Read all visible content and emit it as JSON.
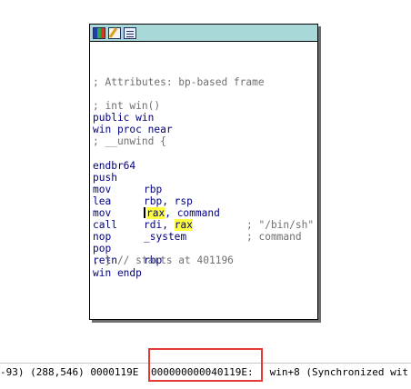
{
  "node": {
    "toolbar_icons": [
      "graph-overview-icon",
      "edit-node-icon",
      "code-view-icon"
    ],
    "attributes_comment": "; Attributes: bp-based frame",
    "signature_comment": "; int win()",
    "public_decl": "public win",
    "proc_decl": "win proc near",
    "unwind_start": "; __unwind {",
    "instructions": [
      {
        "mnemonic": "endbr64",
        "operand": "",
        "comment": ""
      },
      {
        "mnemonic": "push",
        "operand": "rbp",
        "comment": ""
      },
      {
        "mnemonic": "mov",
        "operand": "rbp, rsp",
        "comment": ""
      },
      {
        "mnemonic": "lea",
        "operand": "rax, command",
        "comment": "; \"/bin/sh\""
      },
      {
        "mnemonic": "mov",
        "operand": "rdi, rax",
        "comment": "; command"
      },
      {
        "mnemonic": "call",
        "operand": "_system",
        "comment": ""
      },
      {
        "mnemonic": "nop",
        "operand": "",
        "comment": ""
      },
      {
        "mnemonic": "pop",
        "operand": "rbp",
        "comment": ""
      },
      {
        "mnemonic": "retn",
        "operand": "",
        "comment": ""
      }
    ],
    "unwind_end": "; } // starts at 401196",
    "endp": "win endp"
  },
  "statusbar": {
    "segments": [
      "-93) (288,546) 0000119E ",
      "000000000040119E:",
      " win+8 (Synchronized wit"
    ]
  },
  "highlight_color": "#ffff40",
  "title_bar_color": "#a8d8d8",
  "annotation_color": "#e53935"
}
